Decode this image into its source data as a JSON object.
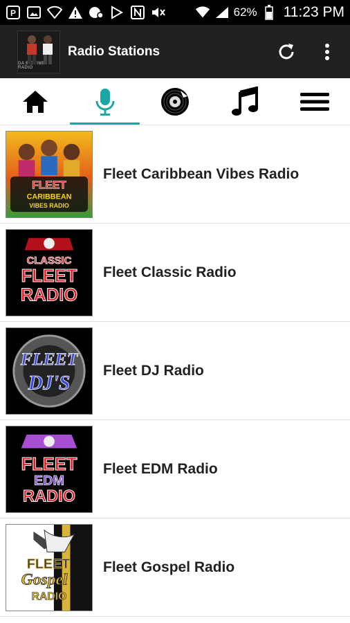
{
  "status_bar": {
    "battery": "62%",
    "time": "11:23 PM"
  },
  "app_bar": {
    "title": "Radio Stations",
    "logo_caption": "DA BIGTIME RADIO"
  },
  "tabs": [
    {
      "icon": "home-icon",
      "active": false
    },
    {
      "icon": "microphone-icon",
      "active": true
    },
    {
      "icon": "vinyl-disc-icon",
      "active": false
    },
    {
      "icon": "music-note-icon",
      "active": false
    },
    {
      "icon": "menu-icon",
      "active": false
    }
  ],
  "stations": [
    {
      "name": "Fleet Caribbean Vibes Radio",
      "logo": {
        "top": "FLEET",
        "mid": "CARIBBEAN",
        "bot": "VIBES RADIO"
      }
    },
    {
      "name": "Fleet Classic Radio",
      "logo": {
        "top": "CLASSIC",
        "mid": "FLEET",
        "bot": "RADIO"
      }
    },
    {
      "name": "Fleet DJ Radio",
      "logo": {
        "top": "FLEET",
        "mid": "DJ'S",
        "bot": ""
      }
    },
    {
      "name": "Fleet EDM Radio",
      "logo": {
        "top": "FLEET",
        "mid": "EDM",
        "bot": "RADIO"
      }
    },
    {
      "name": "Fleet Gospel Radio",
      "logo": {
        "top": "FLEET",
        "mid": "Gospel",
        "bot": "RADIO"
      }
    }
  ],
  "colors": {
    "accent": "#1aa6a3",
    "app_bar": "#212121",
    "status_bar": "#000000"
  }
}
